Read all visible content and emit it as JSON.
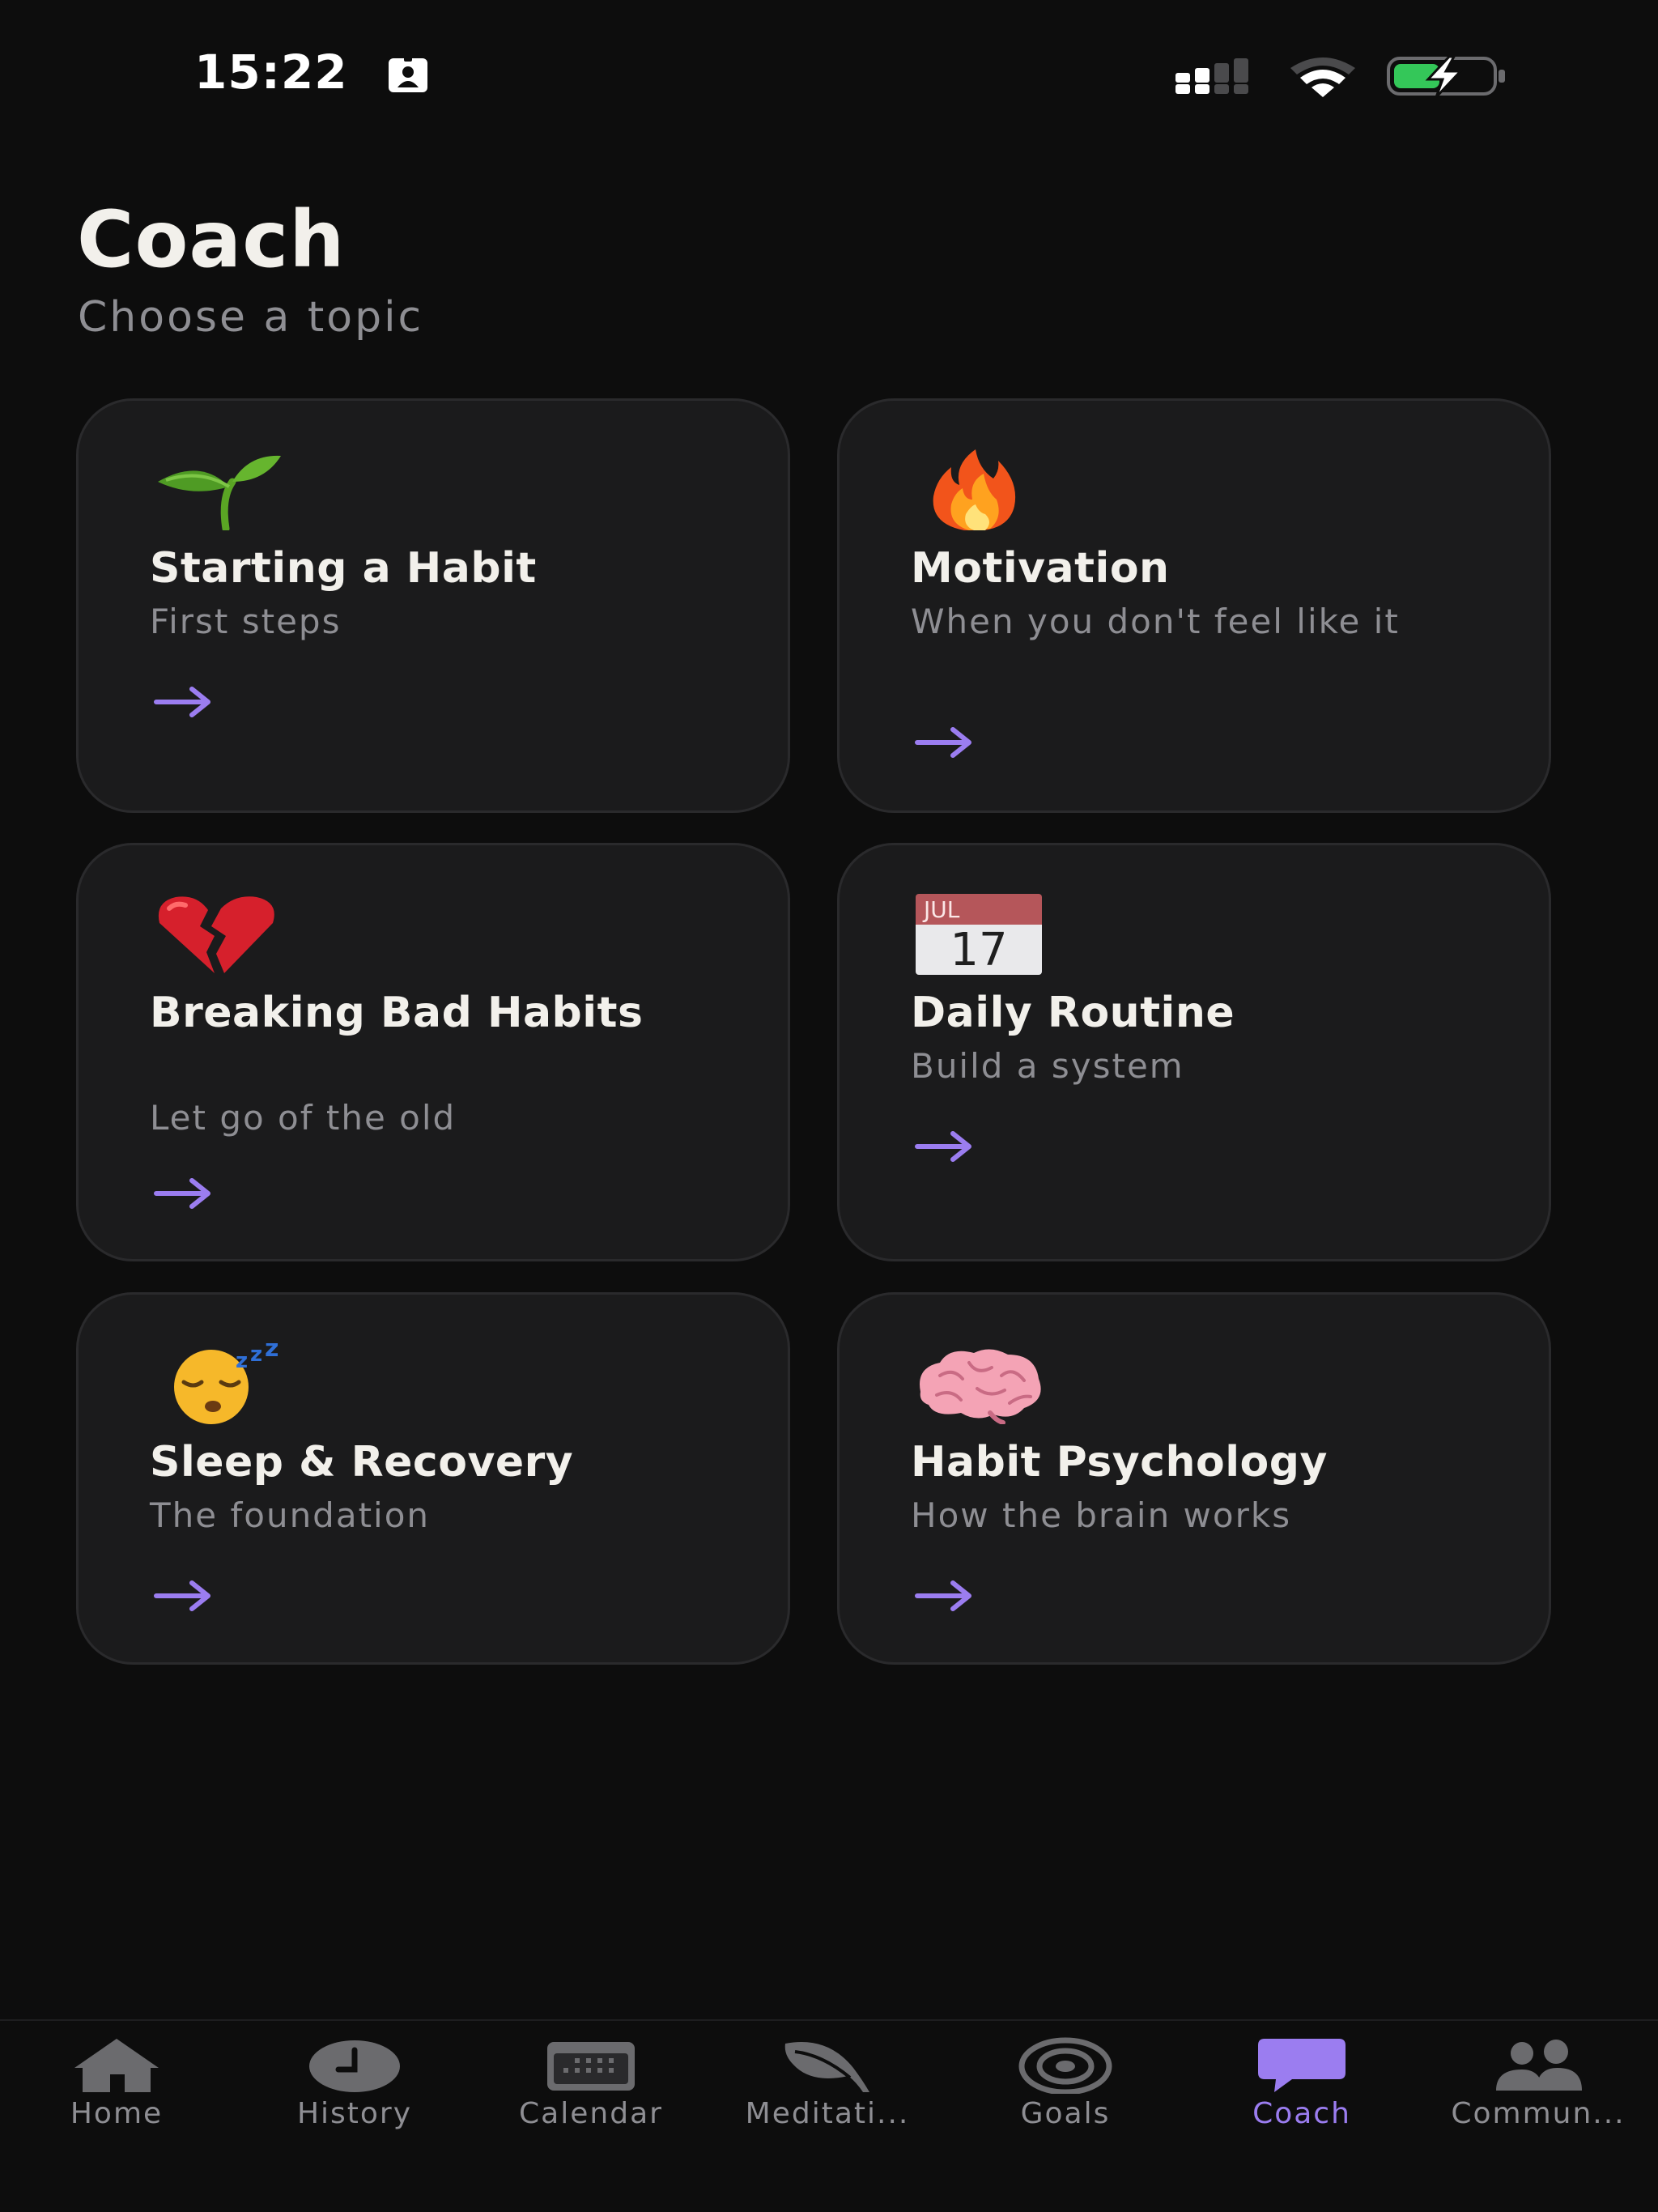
{
  "status_bar": {
    "time": "15:22",
    "battery_color": "#34c759"
  },
  "header": {
    "title": "Coach",
    "subtitle": "Choose a topic"
  },
  "accent_color": "#9b7df0",
  "topics": [
    {
      "icon": "seedling-icon",
      "title": "Starting a Habit",
      "subtitle": "First steps"
    },
    {
      "icon": "fire-icon",
      "title": "Motivation",
      "subtitle": "When you don't feel like it"
    },
    {
      "icon": "broken-heart-icon",
      "title": "Breaking Bad Habits",
      "subtitle": "Let go of the old"
    },
    {
      "icon": "calendar-icon",
      "title": "Daily Routine",
      "subtitle": "Build a system",
      "calendar_month": "JUL",
      "calendar_day": "17"
    },
    {
      "icon": "sleeping-face-icon",
      "title": "Sleep & Recovery",
      "subtitle": "The foundation"
    },
    {
      "icon": "brain-icon",
      "title": "Habit Psychology",
      "subtitle": "How the brain works"
    }
  ],
  "tab_bar": {
    "active": "Coach",
    "tabs": [
      {
        "label": "Home",
        "icon": "home-icon"
      },
      {
        "label": "History",
        "icon": "clock-icon"
      },
      {
        "label": "Calendar",
        "icon": "calendar-grid-icon"
      },
      {
        "label": "Meditati...",
        "icon": "leaf-icon"
      },
      {
        "label": "Goals",
        "icon": "target-icon"
      },
      {
        "label": "Coach",
        "icon": "chat-bubble-icon"
      },
      {
        "label": "Commun...",
        "icon": "people-icon"
      }
    ]
  }
}
